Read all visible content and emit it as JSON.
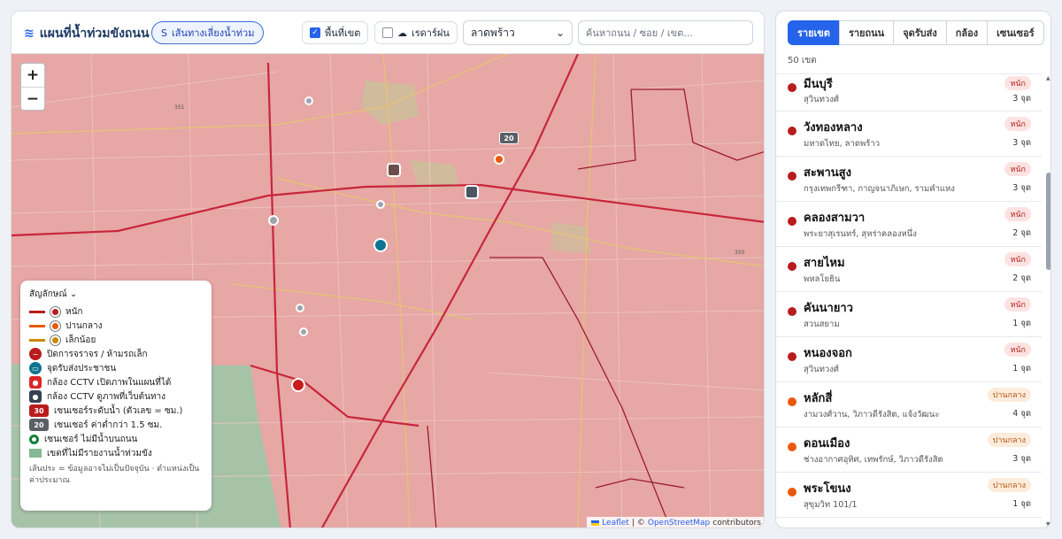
{
  "toolbar": {
    "title": "แผนที่น้ำท่วมขังถนน",
    "route_button": "เส้นทางเลี่ยงน้ำท่วม",
    "areas_label": "พื้นที่เขต",
    "areas_checked": true,
    "radar_label": "เรดาร์ฝน",
    "radar_checked": false,
    "district_select": "ลาดพร้าว",
    "search_placeholder": "ค้นหาถนน / ซอย / เขต..."
  },
  "map": {
    "zoom_in": "+",
    "zoom_out": "−",
    "sensor_badge_1": "20",
    "legend": {
      "title": "สัญลักษณ์",
      "heavy": "หนัก",
      "medium": "ปานกลาง",
      "light": "เล็กน้อย",
      "closed": "ปิดการจราจร / ห้ามรถเล็ก",
      "pump": "จุดรับส่งประชาชน",
      "cctv_on_map": "กล้อง CCTV เปิดภาพในแผนที่ได้",
      "cctv_external": "กล้อง CCTV ดูภาพที่เว็บต้นทาง",
      "sensor_level": "เซนเซอร์ระดับน้ำ (ตัวเลข = ซม.)",
      "sensor_low": "เซนเซอร์ ค่าต่ำกว่า 1.5 ซม.",
      "sensor_dry": "เซนเซอร์ ไม่มีน้ำบนถนน",
      "no_report": "เขตที่ไม่มีรายงานน้ำท่วมขัง",
      "badge_30": "30",
      "badge_20": "20",
      "note": "เส้นประ = ข้อมูลอาจไม่เป็นปัจจุบัน · ตำแหน่งเป็นค่าประมาณ"
    },
    "attribution": {
      "leaflet": "Leaflet",
      "sep": "|",
      "copy": "©",
      "osm": "OpenStreetMap",
      "contributors": "contributors"
    }
  },
  "panel": {
    "tabs": [
      "รายเขต",
      "รายถนน",
      "จุดรับส่ง",
      "กล้อง",
      "เซนเซอร์"
    ],
    "active_tab": "รายเขต",
    "count": "50 เขต",
    "districts": [
      {
        "name": "มีนบุรี",
        "roads": "สุวินทวงศ์",
        "badge": "หนัก",
        "points": "3 จุด",
        "level": "heavy"
      },
      {
        "name": "วังทองหลาง",
        "roads": "มหาดไทย, ลาดพร้าว",
        "badge": "หนัก",
        "points": "3 จุด",
        "level": "heavy"
      },
      {
        "name": "สะพานสูง",
        "roads": "กรุงเทพกรีฑา, กาญจนาภิเษก, รามคำแหง",
        "badge": "หนัก",
        "points": "3 จุด",
        "level": "heavy"
      },
      {
        "name": "คลองสามวา",
        "roads": "พระยาสุเรนทร์, สุหร่าคลองหนึ่ง",
        "badge": "หนัก",
        "points": "2 จุด",
        "level": "heavy"
      },
      {
        "name": "สายไหม",
        "roads": "พหลโยธิน",
        "badge": "หนัก",
        "points": "2 จุด",
        "level": "heavy"
      },
      {
        "name": "คันนายาว",
        "roads": "สวนสยาม",
        "badge": "หนัก",
        "points": "1 จุด",
        "level": "heavy"
      },
      {
        "name": "หนองจอก",
        "roads": "สุวินทวงศ์",
        "badge": "หนัก",
        "points": "1 จุด",
        "level": "heavy"
      },
      {
        "name": "หลักสี่",
        "roads": "งามวงศ์วาน, วิภาวดีรังสิต, แจ้งวัฒนะ",
        "badge": "ปานกลาง",
        "points": "4 จุด",
        "level": "mid"
      },
      {
        "name": "ดอนเมือง",
        "roads": "ช่างอากาศอุทิศ, เทพรักษ์, วิภาวดีรังสิต",
        "badge": "ปานกลาง",
        "points": "3 จุด",
        "level": "mid"
      },
      {
        "name": "พระโขนง",
        "roads": "สุขุมวิท 101/1",
        "badge": "ปานกลาง",
        "points": "1 จุด",
        "level": "mid"
      }
    ]
  },
  "colors": {
    "heavy": "#b91c1c",
    "medium": "#ea580c",
    "light": "#ca8a04",
    "accent": "#2563eb"
  }
}
